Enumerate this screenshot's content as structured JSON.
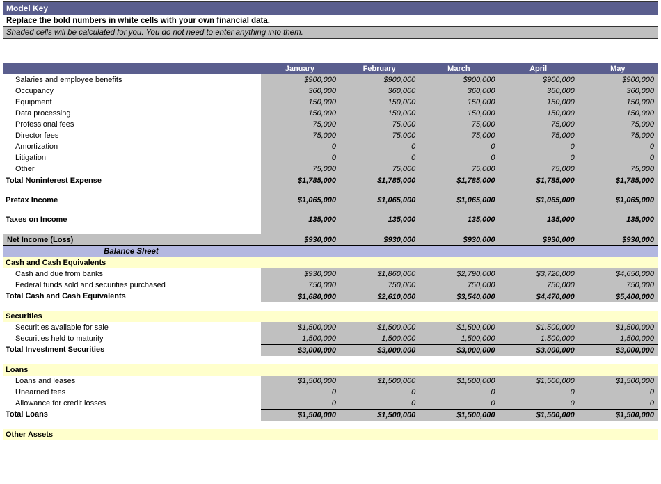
{
  "model_key": {
    "title": "Model Key",
    "line1": "Replace the bold numbers in white cells with your own financial data.",
    "line2": "Shaded cells will be calculated for you. You do not need to enter anything into them."
  },
  "months": [
    "January",
    "February",
    "March",
    "April",
    "May"
  ],
  "balance_sheet_label": "Balance Sheet",
  "rows": {
    "salaries": {
      "label": "Salaries and employee benefits",
      "vals": [
        "$900,000",
        "$900,000",
        "$900,000",
        "$900,000",
        "$900,000"
      ]
    },
    "occupancy": {
      "label": "Occupancy",
      "vals": [
        "360,000",
        "360,000",
        "360,000",
        "360,000",
        "360,000"
      ]
    },
    "equipment": {
      "label": "Equipment",
      "vals": [
        "150,000",
        "150,000",
        "150,000",
        "150,000",
        "150,000"
      ]
    },
    "dataproc": {
      "label": "Data processing",
      "vals": [
        "150,000",
        "150,000",
        "150,000",
        "150,000",
        "150,000"
      ]
    },
    "proffees": {
      "label": "Professional fees",
      "vals": [
        "75,000",
        "75,000",
        "75,000",
        "75,000",
        "75,000"
      ]
    },
    "dirfees": {
      "label": "Director fees",
      "vals": [
        "75,000",
        "75,000",
        "75,000",
        "75,000",
        "75,000"
      ]
    },
    "amort": {
      "label": "Amortization",
      "vals": [
        "0",
        "0",
        "0",
        "0",
        "0"
      ]
    },
    "litig": {
      "label": "Litigation",
      "vals": [
        "0",
        "0",
        "0",
        "0",
        "0"
      ]
    },
    "other": {
      "label": "Other",
      "vals": [
        "75,000",
        "75,000",
        "75,000",
        "75,000",
        "75,000"
      ]
    },
    "tot_nonint": {
      "label": "Total Noninterest Expense",
      "vals": [
        "$1,785,000",
        "$1,785,000",
        "$1,785,000",
        "$1,785,000",
        "$1,785,000"
      ]
    },
    "pretax": {
      "label": "Pretax Income",
      "vals": [
        "$1,065,000",
        "$1,065,000",
        "$1,065,000",
        "$1,065,000",
        "$1,065,000"
      ]
    },
    "taxes": {
      "label": "Taxes on Income",
      "vals": [
        "135,000",
        "135,000",
        "135,000",
        "135,000",
        "135,000"
      ]
    },
    "netinc": {
      "label": "Net Income (Loss)",
      "vals": [
        "$930,000",
        "$930,000",
        "$930,000",
        "$930,000",
        "$930,000"
      ]
    },
    "cash_hdr": {
      "label": "Cash and Cash Equivalents"
    },
    "cashdue": {
      "label": "Cash and due from banks",
      "vals": [
        "$930,000",
        "$1,860,000",
        "$2,790,000",
        "$3,720,000",
        "$4,650,000"
      ]
    },
    "fedfunds": {
      "label": "Federal funds sold and securities purchased",
      "vals": [
        "750,000",
        "750,000",
        "750,000",
        "750,000",
        "750,000"
      ]
    },
    "tot_cash": {
      "label": "Total Cash and Cash Equivalents",
      "vals": [
        "$1,680,000",
        "$2,610,000",
        "$3,540,000",
        "$4,470,000",
        "$5,400,000"
      ]
    },
    "sec_hdr": {
      "label": "Securities"
    },
    "sec_afs": {
      "label": "Securities available for sale",
      "vals": [
        "$1,500,000",
        "$1,500,000",
        "$1,500,000",
        "$1,500,000",
        "$1,500,000"
      ]
    },
    "sec_htm": {
      "label": "Securities held to maturity",
      "vals": [
        "1,500,000",
        "1,500,000",
        "1,500,000",
        "1,500,000",
        "1,500,000"
      ]
    },
    "tot_sec": {
      "label": "Total Investment Securities",
      "vals": [
        "$3,000,000",
        "$3,000,000",
        "$3,000,000",
        "$3,000,000",
        "$3,000,000"
      ]
    },
    "loans_hdr": {
      "label": "Loans"
    },
    "loanslease": {
      "label": "Loans and leases",
      "vals": [
        "$1,500,000",
        "$1,500,000",
        "$1,500,000",
        "$1,500,000",
        "$1,500,000"
      ]
    },
    "unearned": {
      "label": "Unearned fees",
      "vals": [
        "0",
        "0",
        "0",
        "0",
        "0"
      ]
    },
    "allowance": {
      "label": "Allowance for credit losses",
      "vals": [
        "0",
        "0",
        "0",
        "0",
        "0"
      ]
    },
    "tot_loans": {
      "label": "Total Loans",
      "vals": [
        "$1,500,000",
        "$1,500,000",
        "$1,500,000",
        "$1,500,000",
        "$1,500,000"
      ]
    },
    "other_assets_hdr": {
      "label": "Other Assets"
    }
  }
}
